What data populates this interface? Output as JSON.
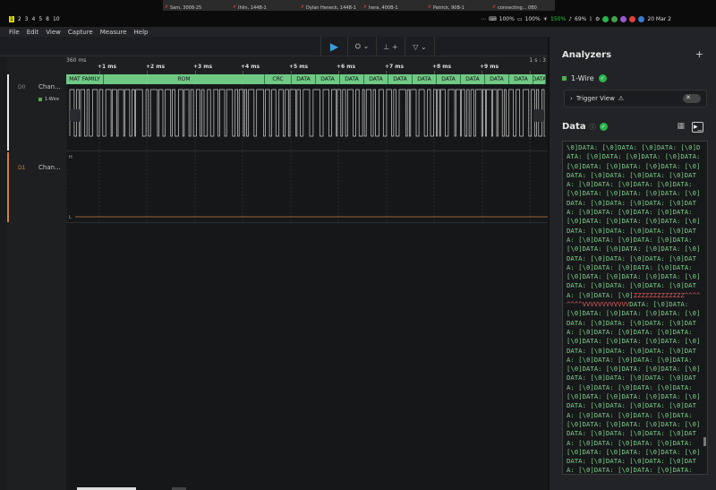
{
  "sysbar": {
    "workspaces": [
      "1",
      "2",
      "3",
      "4",
      "5",
      "8",
      "10"
    ],
    "active_workspace": "1",
    "participants": [
      {
        "name": "Sam, 3008-25"
      },
      {
        "name": "Ihlin, 144B-1"
      },
      {
        "name": "Dylan Heneck, 144B-1"
      },
      {
        "name": "hera, 400B-1"
      },
      {
        "name": "Patrick, 90B-1"
      },
      {
        "name": "connecting... 0B0"
      }
    ],
    "battery_1": "100%",
    "battery_2": "100%",
    "brightness": "150%",
    "volume": "69%",
    "date": "20 Mar 2"
  },
  "menu": [
    "File",
    "Edit",
    "View",
    "Capture",
    "Measure",
    "Help"
  ],
  "timeline": {
    "start": "360 ms",
    "end": "1 s : 3",
    "ticks": [
      "+1 ms",
      "+2 ms",
      "+3 ms",
      "+4 ms",
      "+5 ms",
      "+6 ms",
      "+7 ms",
      "+8 ms",
      "+9 ms"
    ]
  },
  "channels": [
    {
      "id": "D0",
      "name": "Chan...",
      "analyzer": "1-Wire"
    },
    {
      "id": "D1",
      "name": "Chan..."
    }
  ],
  "protocol_cells": [
    "MAT FAMILY",
    "ROM",
    "CRC",
    "DATA",
    "DATA",
    "DATA",
    "DATA",
    "DATA",
    "DATA",
    "DATA",
    "DATA",
    "DATA",
    "DATA",
    "DATA"
  ],
  "d1_labels": {
    "high": "H",
    "low": "L"
  },
  "panel": {
    "title": "Analyzers",
    "add": "+",
    "analyzer_name": "1-Wire",
    "trigger_view": "Trigger View",
    "data_title": "Data",
    "data_lines": [
      {
        "t": "\\0]DATA: [\\0]DATA: [\\0]DATA: [\\0]DATA: [\\0]DATA: [\\0]DATA: [\\0]DATA: [\\0]DATA: [\\0]DATA: [\\0]DATA: [\\0]DATA: [\\0]DATA: [\\0]DATA: [\\0]DATA: [\\0]DATA: [\\0]DATA: [\\0]DATA: [\\0]DATA: [\\0]DATA: [\\0]DATA: [\\0]DATA: [\\0]DATA: [\\0]DATA: [\\0]DATA: [\\0]DATA: [\\0]DATA: [\\0]DATA: [\\0]DATA: [\\0]DATA: [\\0]DATA: [\\0]DATA: [\\0]DATA: [\\0]DATA: [\\0]DATA: [\\0]DATA: [\\0]DATA: [\\0]DATA: [\\0]DATA: [\\0]DATA: [\\0]DATA: [\\0]DATA: [\\0]DATA: [\\0]DATA: [\\0]DATA: [\\0]DATA: [\\0]DATA: [\\0]DATA: [\\0]DATA: [\\0]DATA: [\\0]DATA: [\\0]DATA: [\\0]DATA: [\\0]DATA: [\\0]DATA: [\\0]DATA: [\\0]",
        "red": false
      },
      {
        "t": "ZZZZZZZZZZZZZ^^^^^^^^",
        "red": true
      },
      {
        "t": "VVVVVVVVVVVV",
        "red": true
      },
      {
        "t": "DATA: [\\0]DATA: [\\0]DATA: [\\0]DATA: [\\0]DATA: [\\0]DATA: [\\0]DATA: [\\0]DATA: [\\0]DATA: [\\0]DATA: [\\0]DATA: [\\0]DATA: [\\0]DATA: [\\0]DATA: [\\0]DATA: [\\0]DATA: [\\0]DATA: [\\0]DATA: [\\0]DATA: [\\0]DATA: [\\0]DATA: [\\0]DATA: [\\0]DATA: [\\0]DATA: [\\0]DATA: [\\0]DATA: [\\0]DATA: [\\0]DATA: [\\0]DATA: [\\0]DATA: [\\0]DATA: [\\0]DATA: [\\0]DATA: [\\0]DATA: [\\0]DATA: [\\0]DATA: [\\0]DATA: [\\0]DATA: [\\0]DATA: [\\0]DATA: [\\0]DATA: [\\0]DATA: [\\0]DATA: [\\0]DATA: [\\0]DATA: [\\0]DATA: [\\0]DATA: [\\0]DATA: [\\0]DATA: [\\0]DATA: [\\0]DATA: [\\0]DATA: [\\0]DATA: [\\0]DATA: [\\0]DATA: [\\0]DATA: [\\0]DATA: [\\0]DATA: [\\0]DATA: [\\0]DATA: [\\0]DATA: [\\0]DATA: [\\0]DATA: [\\0]",
        "red": false
      }
    ]
  }
}
